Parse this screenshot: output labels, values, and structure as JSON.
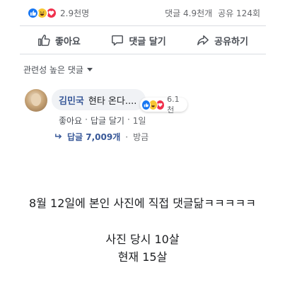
{
  "post_meta": {
    "reaction_count": "2.9천명",
    "comment_count": "댓글 4.9천개",
    "share_count": "공유 124회"
  },
  "actions": {
    "like": "좋아요",
    "comment": "댓글 달기",
    "share": "공유하기"
  },
  "sort": {
    "label": "관련성 높은 댓글"
  },
  "comment": {
    "author": "김민국",
    "text": "현타 온다....",
    "reaction_count": "6.1천",
    "like": "좋아요",
    "reply": "답글 달기",
    "time": "1일",
    "dot": "·"
  },
  "replies": {
    "label": "답글 7,009개",
    "time": "방금",
    "dot": "·"
  },
  "caption": {
    "line1": "8월 12일에 본인 사진에 직접 댓글닮ㅋㅋㅋㅋㅋ",
    "line2": "사진 당시 10살",
    "line3": "현재 15살"
  },
  "colors": {
    "like_blue": "#1877f2",
    "haha_yellow": "#f7c632",
    "love_red": "#f0314d",
    "link_blue": "#385898"
  },
  "icons": [
    "like-reaction-icon",
    "haha-reaction-icon",
    "love-reaction-icon",
    "thumbs-up-icon",
    "comment-icon",
    "share-icon",
    "chevron-down-icon",
    "reply-arrow-icon"
  ]
}
